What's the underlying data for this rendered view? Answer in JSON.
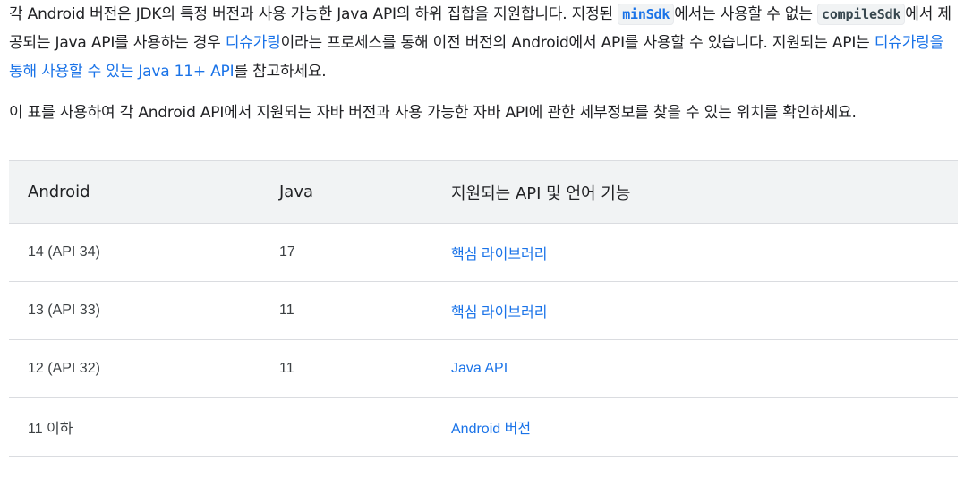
{
  "intro": {
    "p1_part1": "각 Android 버전은 JDK의 특정 버전과 사용 가능한 Java API의 하위 집합을 지원합니다. 지정된 ",
    "p1_code_minsdk": "minSdk",
    "p1_part2": "에서는 사용할 수 없는 ",
    "p1_code_compilesdk": "compileSdk",
    "p1_part3": "에서 제공되는 Java API를 사용하는 경우 ",
    "p1_link_desugaring": "디슈가링",
    "p1_part4": "이라는 프로세스를 통해 이전 버전의 Android에서 API를 사용할 수 있습니다. 지원되는 API는 ",
    "p1_link_java11": "디슈가링을 통해 사용할 수 있는 Java 11+ API",
    "p1_part5": "를 참고하세요.",
    "p2": "이 표를 사용하여 각 Android API에서 지원되는 자바 버전과 사용 가능한 자바 API에 관한 세부정보를 찾을 수 있는 위치를 확인하세요."
  },
  "table": {
    "headers": {
      "android": "Android",
      "java": "Java",
      "features": "지원되는 API 및 언어 기능"
    },
    "rows": [
      {
        "android": "14 (API 34)",
        "java": "17",
        "link": "핵심 라이브러리"
      },
      {
        "android": "13 (API 33)",
        "java": "11",
        "link": "핵심 라이브러리"
      },
      {
        "android": "12 (API 32)",
        "java": "11",
        "link": "Java API"
      },
      {
        "android": "11 이하",
        "java": "",
        "link": "Android 버전"
      }
    ]
  },
  "colors": {
    "link": "#1a73e8",
    "text": "#202124",
    "header_bg": "#f1f3f4",
    "border": "#dadce0"
  }
}
